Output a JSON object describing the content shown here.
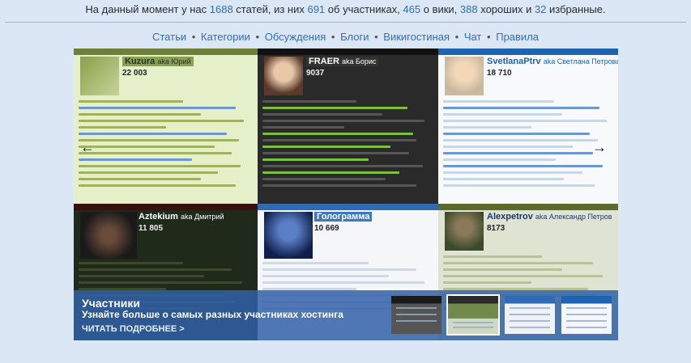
{
  "stats": {
    "prefix": "На данный момент у нас ",
    "articles": "1688",
    "mid1": " статей, из них ",
    "members": "691",
    "mid2": " об участниках, ",
    "wiki": "465",
    "mid3": " о вики, ",
    "good": "388",
    "mid4": " хороших и ",
    "featured": "32",
    "suffix": " избранные."
  },
  "nav": [
    {
      "label": "Статьи"
    },
    {
      "label": "Категории"
    },
    {
      "label": "Обсуждения"
    },
    {
      "label": "Блоги"
    },
    {
      "label": "Викигостиная"
    },
    {
      "label": "Чат"
    },
    {
      "label": "Правила"
    }
  ],
  "nav_separator": "•",
  "slider": {
    "arrow_left": "←",
    "arrow_right": "→",
    "caption_title": "Участники",
    "caption_subtitle": "Узнайте больше о самых разных участниках хостинга",
    "caption_more": "ЧИТАТЬ ПОДРОБНЕЕ >",
    "active_thumb": 2,
    "tiles": [
      {
        "username": "Kuzura",
        "aka": "aka Юрий",
        "count": "22 003"
      },
      {
        "username": "FRAER",
        "aka": "aka Борис",
        "count": "9037"
      },
      {
        "username": "SvetlanaPtrv",
        "aka": "aka Светлана Петрова",
        "count": "18 710"
      },
      {
        "username": "Aztekium",
        "aka": "aka Дмитрий",
        "count": "11 805"
      },
      {
        "username": "Гологрaмма",
        "aka": "",
        "count": "10 669"
      },
      {
        "username": "Alexpetrov",
        "aka": "aka Александр Петров",
        "count": "8173"
      }
    ]
  }
}
